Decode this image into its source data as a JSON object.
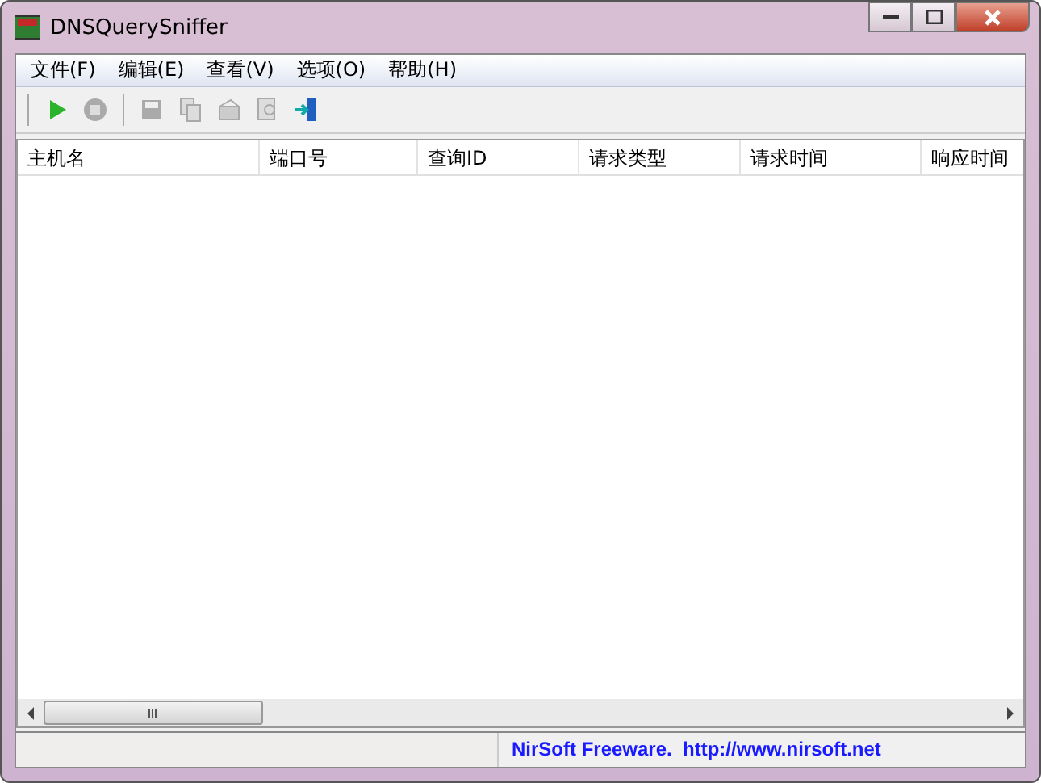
{
  "window": {
    "title": "DNSQuerySniffer"
  },
  "menu": [
    "文件(F)",
    "编辑(E)",
    "查看(V)",
    "选项(O)",
    "帮助(H)"
  ],
  "toolbar": [
    {
      "kind": "play",
      "disabled": false
    },
    {
      "kind": "stop",
      "disabled": true
    },
    {
      "kind": "save",
      "disabled": true
    },
    {
      "kind": "copy",
      "disabled": true
    },
    {
      "kind": "properties",
      "disabled": true
    },
    {
      "kind": "find",
      "disabled": true
    },
    {
      "kind": "exit",
      "disabled": false
    }
  ],
  "table": {
    "columns": [
      "主机名",
      "端口号",
      "查询ID",
      "请求类型",
      "请求时间",
      "响应时间"
    ]
  },
  "status_bar": {
    "text": "NirSoft Freeware.  http://www.nirsoft.net"
  }
}
